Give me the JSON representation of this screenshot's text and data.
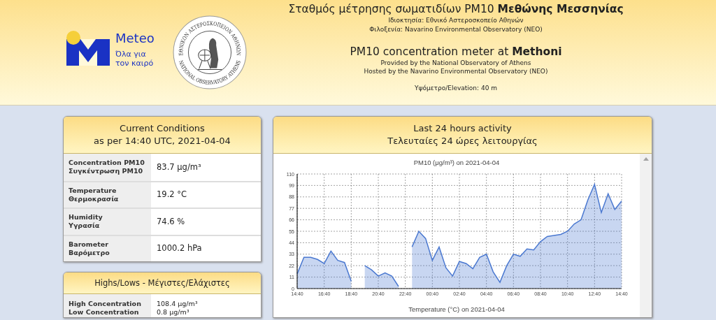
{
  "header": {
    "meteo_logo": {
      "name": "Meteo",
      "tagline_1": "Όλα για",
      "tagline_2": "τον καιρό"
    },
    "seal": {
      "top_text": "ΕΘΝΙΚΟΝ ΑΣΤΕΡΟΣΚΟΠΕΙΟΝ ΑΘΗΝΩΝ",
      "bottom_text": "NATIONAL OBSERVATORY ATHENS"
    },
    "title_gr": "Σταθμός μέτρησης σωματιδίων PM10 **Μεθώνης Μεσσηνίας**",
    "owner_gr": "Ιδιοκτησία: Εθνικό Αστεροσκοπείο Αθηνών",
    "host_gr": "Φιλοξενία: Navarino Environmental Observatory (NEO)",
    "title_en": "PM10 concentration meter at **Methoni**",
    "provided_en": "Provided by the National Observatory of Athens",
    "hosted_en": "Hosted by the Navarino Environmental Observatory (NEO)",
    "elevation": "Υψόμετρο/Elevation: 40 m"
  },
  "current": {
    "title_1": "Current Conditions",
    "title_2": "as per 14:40 UTC, 2021-04-04",
    "rows": [
      {
        "label_en": "Concentration PM10",
        "label_gr": "Συγκέντρωση PM10",
        "value": "83.7 μg/m³"
      },
      {
        "label_en": "Temperature",
        "label_gr": "Θερμοκρασία",
        "value": "19.2 °C"
      },
      {
        "label_en": "Humidity",
        "label_gr": "Υγρασία",
        "value": "74.6 %"
      },
      {
        "label_en": "Barometer",
        "label_gr": "Βαρόμετρο",
        "value": "1000.2 hPa"
      }
    ]
  },
  "highs_lows": {
    "title": "Highs/Lows - Μέγιστες/Ελάχιστες",
    "rows": [
      {
        "label": "High Concentration",
        "value": "108.4 μg/m³"
      },
      {
        "label": "Low Concentration",
        "value": "0.8 μg/m³"
      }
    ]
  },
  "activity": {
    "title_1": "Last 24 hours activity",
    "title_2": "Τελευταίες 24 ώρες λειτουργίας",
    "chart_data": {
      "type": "area",
      "title": "PM10 (μg/m³) on 2021-04-04",
      "categories": [
        "14:40",
        null,
        null,
        null,
        "16:40",
        null,
        null,
        null,
        "18:40",
        null,
        null,
        null,
        "20:40",
        null,
        null,
        null,
        "22:40",
        null,
        null,
        null,
        "00:40",
        null,
        null,
        null,
        "02:40",
        null,
        null,
        null,
        "04:40",
        null,
        null,
        null,
        "06:40",
        null,
        null,
        null,
        "08:40",
        null,
        null,
        null,
        "10:40",
        null,
        null,
        null,
        "12:40",
        null,
        null,
        null,
        "14:40"
      ],
      "grid": true,
      "series": [
        {
          "color": "#4a78d0",
          "values": [
            14,
            30,
            30,
            28,
            24,
            36,
            27,
            25,
            7,
            null,
            22,
            18,
            12,
            15,
            12,
            2,
            null,
            40,
            55,
            48,
            27,
            40,
            20,
            12,
            26,
            24,
            19,
            30,
            33,
            16,
            6,
            22,
            33,
            31,
            38,
            37,
            45,
            50,
            51,
            52,
            55,
            62,
            66,
            85,
            100,
            73,
            91,
            76,
            84
          ]
        }
      ],
      "ylim": [
        0,
        110
      ],
      "yticks": [
        0,
        11,
        22,
        33,
        44,
        55,
        66,
        77,
        88,
        99,
        110
      ]
    },
    "next_chart_title": "Temperature (°C) on 2021-04-04"
  }
}
